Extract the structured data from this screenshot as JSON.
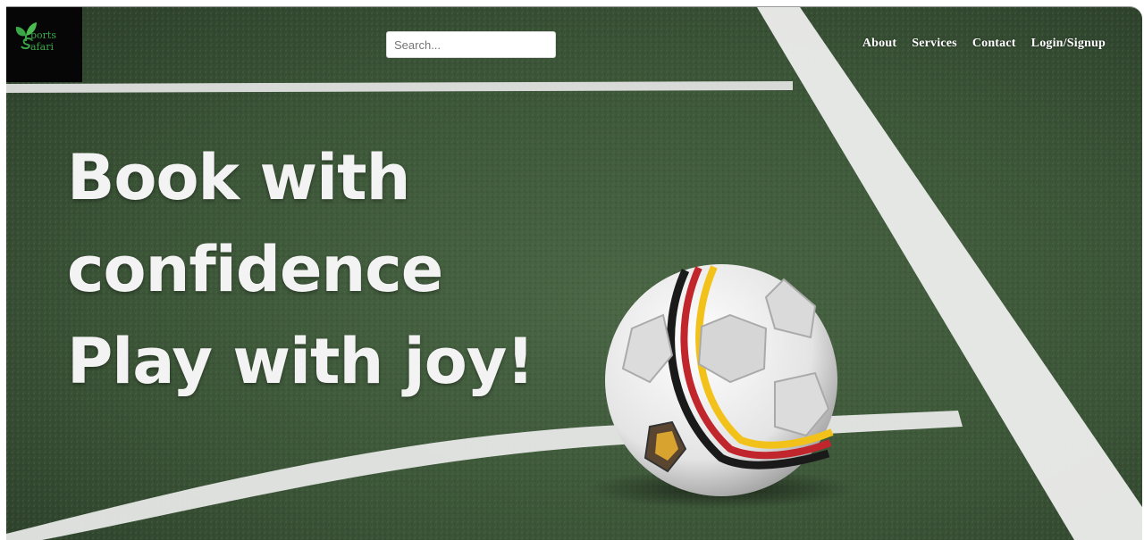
{
  "brand": {
    "logo_line1": "ports",
    "logo_line2": "afari",
    "logo_icon": "leaf-s-icon",
    "accent": "#3aa648"
  },
  "search": {
    "placeholder": "Search...",
    "value": ""
  },
  "nav": {
    "items": [
      "About",
      "Services",
      "Contact",
      "Login/Signup"
    ]
  },
  "hero": {
    "line1": "Book with",
    "line2": "confidence",
    "line3": "Play with joy!",
    "background": "soccer-ball-on-turf-image"
  },
  "colors": {
    "turf": "#3f5a3a",
    "lines": "#f2f2f2",
    "logo_bg": "#060606"
  }
}
